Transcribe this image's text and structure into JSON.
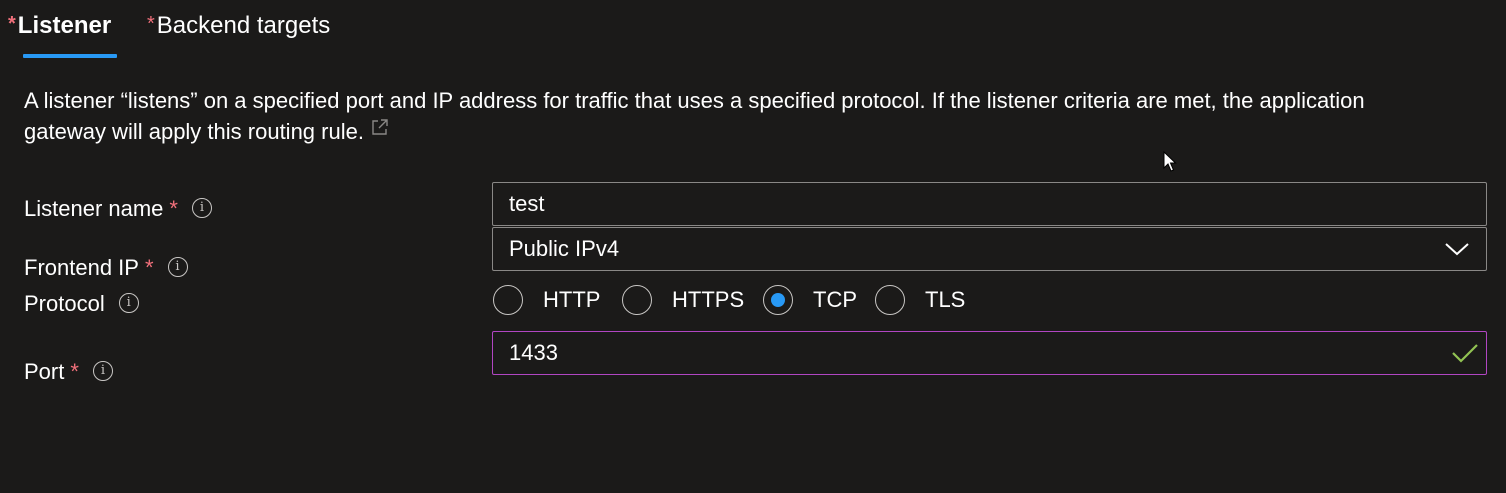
{
  "tabs": [
    {
      "label": "Listener",
      "required_mark": "*",
      "active": true
    },
    {
      "label": "Backend targets",
      "required_mark": "*",
      "active": false
    }
  ],
  "description": {
    "text": "A listener “listens” on a specified port and IP address for traffic that uses a specified protocol. If the listener criteria are met, the application gateway will apply this routing rule."
  },
  "form": {
    "required_mark": "*",
    "listener_name": {
      "label": "Listener name",
      "value": "test"
    },
    "frontend_ip": {
      "label": "Frontend IP",
      "value": "Public IPv4"
    },
    "protocol": {
      "label": "Protocol",
      "options": [
        "HTTP",
        "HTTPS",
        "TCP",
        "TLS"
      ],
      "selected": "TCP"
    },
    "port": {
      "label": "Port",
      "value": "1433",
      "valid": true
    }
  },
  "colors": {
    "background": "#1b1a19",
    "accent": "#2899f5",
    "required": "#f1707b",
    "focus_border": "#b146c2",
    "valid": "#92c353"
  },
  "icons": [
    "external-link-icon",
    "info-icon",
    "chevron-down-icon",
    "checkmark-icon",
    "mouse-cursor-icon"
  ]
}
